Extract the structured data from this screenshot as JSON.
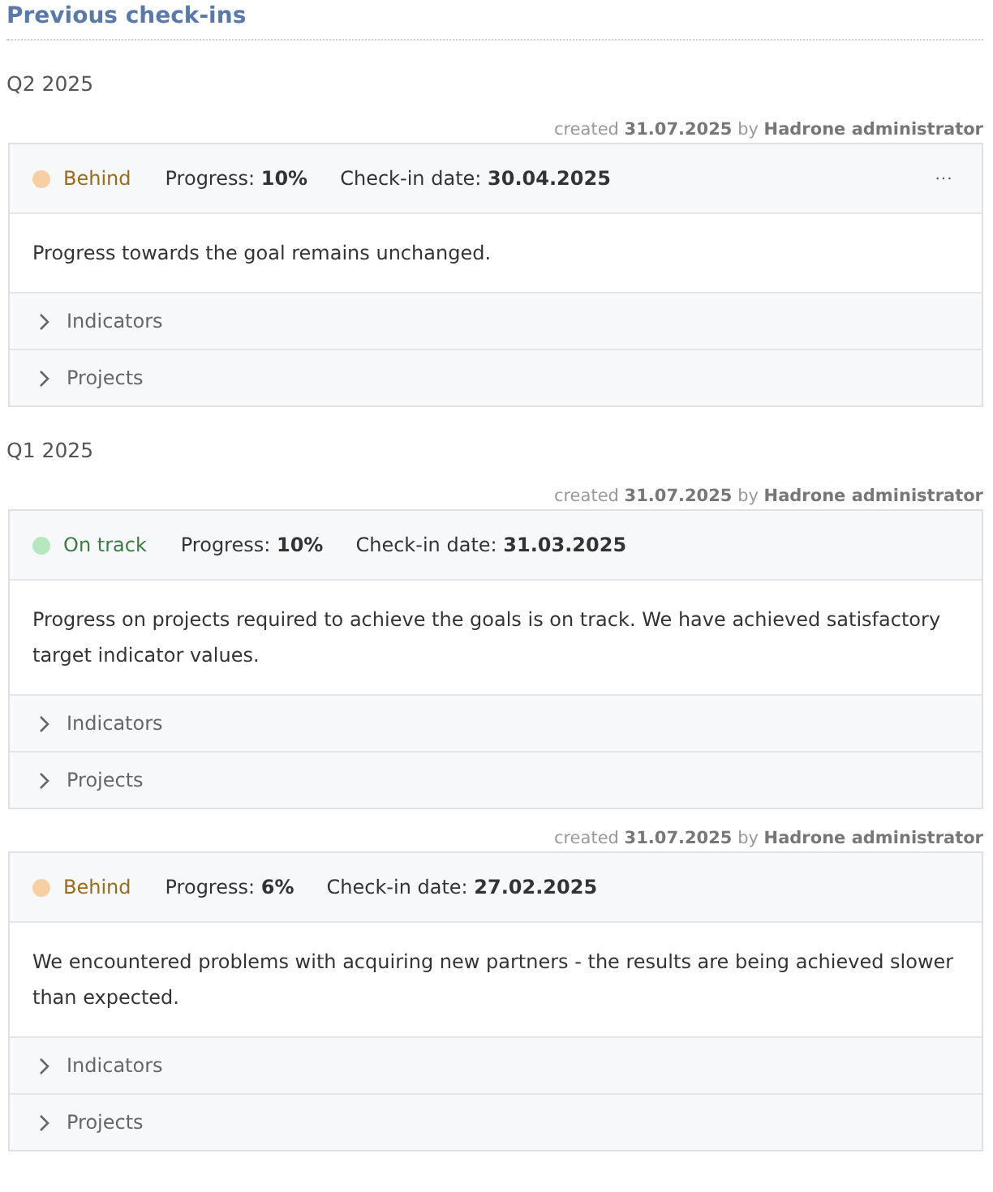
{
  "title": "Previous check-ins",
  "groups": [
    {
      "label": "Q2 2025",
      "checkins": [
        {
          "created": "created **31.07.2025** by **Hadrone administrator**",
          "status": {
            "label": "Behind",
            "kind": "behind",
            "color": "#f8cfa2"
          },
          "progress": "Progress: **10%**",
          "date": "Check-in date: **30.04.2025**",
          "menu": "···",
          "text": "Progress towards the goal remains unchanged.",
          "sections": [
            {
              "label": "Indicators",
              "expanded": false
            },
            {
              "label": "Projects",
              "expanded": false
            }
          ]
        }
      ]
    },
    {
      "label": "Q1 2025",
      "checkins": [
        {
          "created": "created **31.07.2025** by **Hadrone administrator**",
          "status": {
            "label": "On track",
            "kind": "on_track",
            "color": "#b5e8bd"
          },
          "progress": "Progress: **10%**",
          "date": "Check-in date: **31.03.2025**",
          "text": "Progress on projects required to achieve the goals is on track. We have achieved satisfactory target indicator values.",
          "sections": [
            {
              "label": "Indicators",
              "expanded": false
            },
            {
              "label": "Projects",
              "expanded": false
            }
          ]
        },
        {
          "created": "created **31.07.2025** by **Hadrone administrator**",
          "status": {
            "label": "Behind",
            "kind": "behind",
            "color": "#f8cfa2"
          },
          "progress": "Progress: **6%**",
          "date": "Check-in date: **27.02.2025**",
          "text": "We encountered problems with acquiring new partners - the results are being achieved slower than expected.",
          "sections": [
            {
              "label": "Indicators",
              "expanded": false
            },
            {
              "label": "Projects",
              "expanded": false
            }
          ]
        }
      ]
    }
  ]
}
